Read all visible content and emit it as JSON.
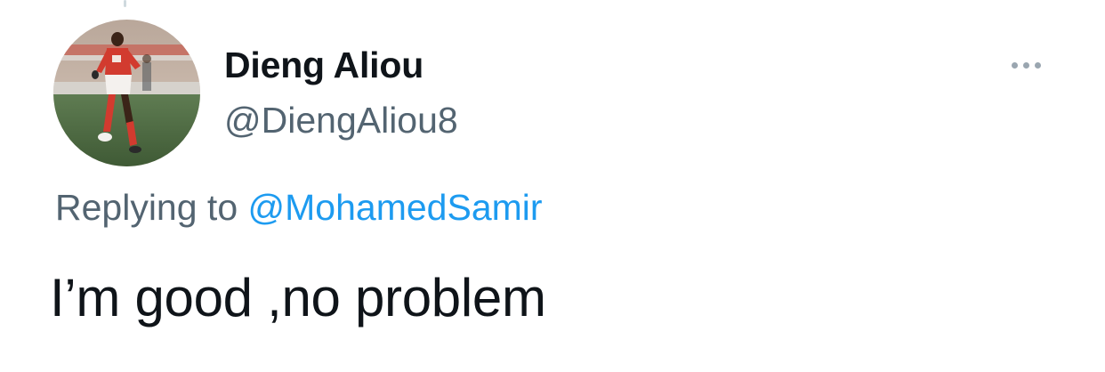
{
  "tweet": {
    "display_name": "Dieng Aliou",
    "handle": "@DiengAliou8",
    "reply_prefix": "Replying to",
    "reply_target": "@MohamedSamir",
    "text": "I’m good ,no problem",
    "avatar_description_icon": "footballer-photo",
    "more_icon": "more-options-icon"
  },
  "colors": {
    "name": "#0f1419",
    "secondary": "#536471",
    "link": "#1d9bf0",
    "menu_dots": "#9aa6b0"
  }
}
